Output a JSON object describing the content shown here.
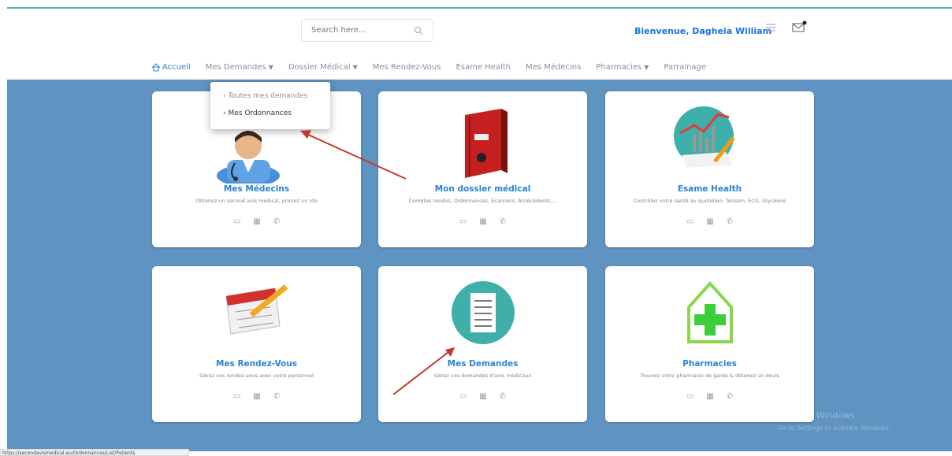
{
  "header": {
    "search_placeholder": "Search here...",
    "welcome": "Bienvenue, Dagheia William",
    "icons": [
      "menu-icon",
      "mail-icon"
    ]
  },
  "nav": {
    "home": "Accueil",
    "demandes": "Mes Demandes",
    "dossier": "Dossier Médical",
    "rdv": "Mes Rendez-Vous",
    "esame": "Esame Health",
    "medecins": "Mes Médecins",
    "pharmacies": "Pharmacies",
    "parrainage": "Parrainage"
  },
  "dropdown": {
    "item1": "Toutes mes demandes",
    "item2": "Mes Ordonnances"
  },
  "cards": {
    "medecins": {
      "title": "Mes Médecins",
      "desc": "Obtenez un second avis medical, prenez un rdv"
    },
    "dossier": {
      "title": "Mon dossier médical",
      "desc": "Comptes rendus, Ordonnances, Scanners, Antécédents,..."
    },
    "esame": {
      "title": "Esame Health",
      "desc": "Contrôlez votre santé au quotidien: Tension, ECG, Glycémie"
    },
    "rdv": {
      "title": "Mes Rendez-Vous",
      "desc": "Gérez vos rendez-vous avec votre personnel"
    },
    "demandes": {
      "title": "Mes Demandes",
      "desc": "Gérez vos demandes d'avis médicaux"
    },
    "pharmacies": {
      "title": "Pharmacies",
      "desc": "Trouvez votre pharmacie de garde & obtenez un devis"
    }
  },
  "card_actions": [
    "video-icon",
    "calendar-icon",
    "phone-icon"
  ],
  "watermark": {
    "line1": "Activate Windows",
    "line2": "Go to Settings to activate Windows."
  },
  "status_url": "https://secondavismedical.eu/Ordonnances/List/Patients",
  "colors": {
    "accent": "#2a82d6",
    "background": "#5f93c2",
    "teal": "#44b6b5",
    "arrow": "#c0392b"
  }
}
